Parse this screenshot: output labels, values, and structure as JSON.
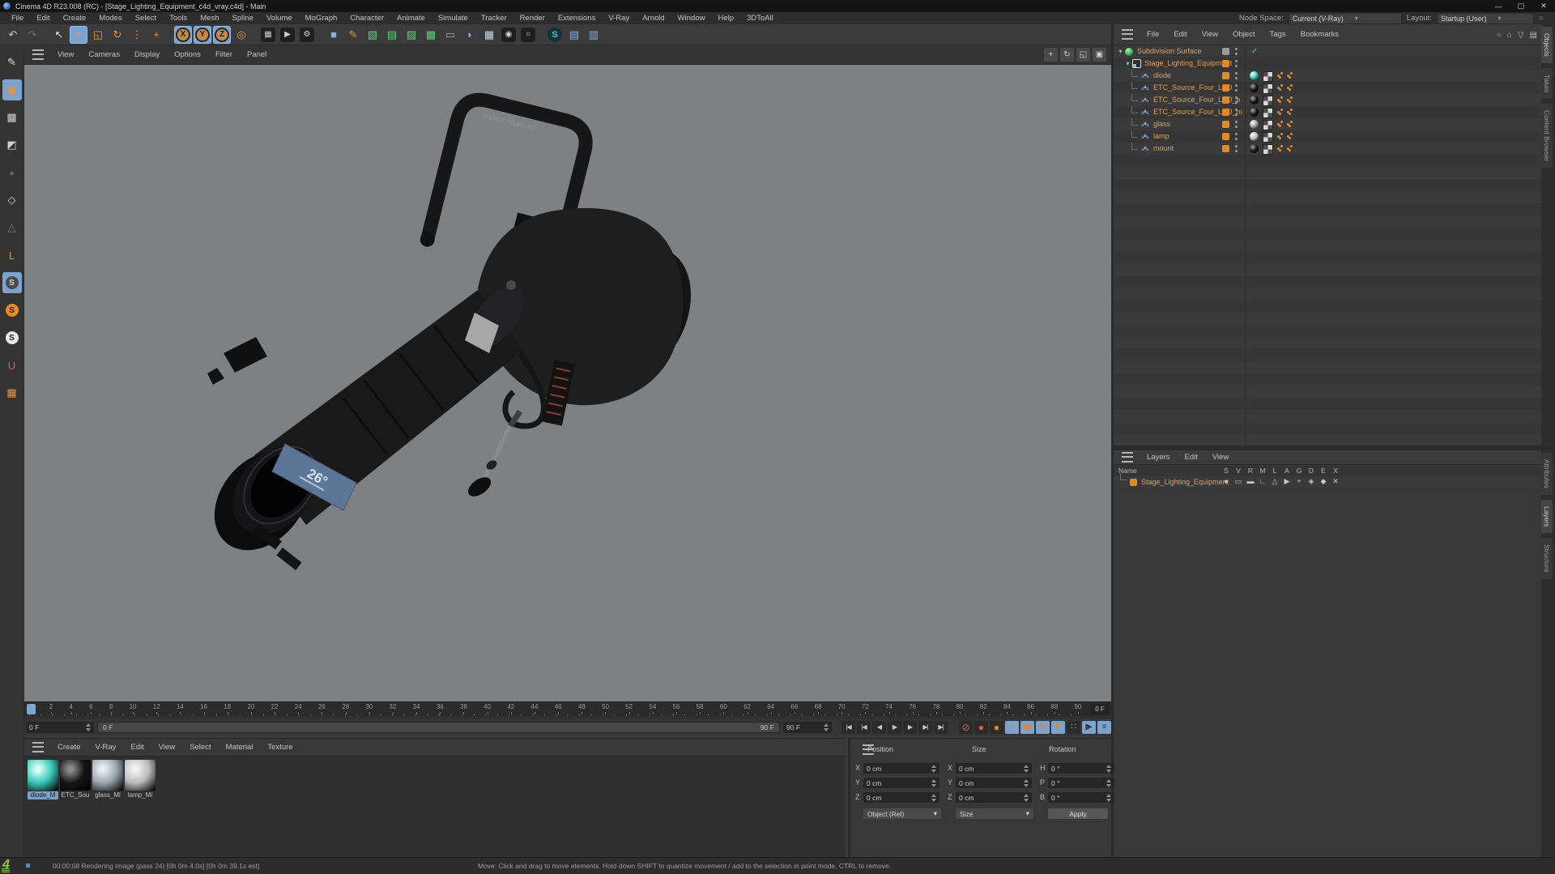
{
  "window": {
    "title": "Cinema 4D R23.008 (RC) - [Stage_Lighting_Equipment_c4d_vray.c4d] - Main",
    "minimize": "—",
    "maximize": "▢",
    "close": "✕"
  },
  "menubar": {
    "items": [
      "File",
      "Edit",
      "Create",
      "Modes",
      "Select",
      "Tools",
      "Mesh",
      "Spline",
      "Volume",
      "MoGraph",
      "Character",
      "Animate",
      "Simulate",
      "Tracker",
      "Render",
      "Extensions",
      "V-Ray",
      "Arnold",
      "Window",
      "Help",
      "3DToAll"
    ],
    "node_space_label": "Node Space:",
    "node_space_value": "Current (V-Ray)",
    "layout_label": "Layout:",
    "layout_value": "Startup (User)",
    "dropdown_caret": "▾"
  },
  "toolbar": {
    "items": [
      {
        "n": "undo-button",
        "g": "↶",
        "c": "#c8c8c8"
      },
      {
        "n": "redo-button",
        "g": "↷",
        "c": "#6a6a6a"
      },
      {
        "n": "sep"
      },
      {
        "n": "live-selection-tool",
        "g": "↖",
        "c": "#e6e6e6"
      },
      {
        "n": "move-tool",
        "g": "+",
        "c": "#e8953c",
        "active": 1
      },
      {
        "n": "scale-tool",
        "g": "◱",
        "c": "#e8953c"
      },
      {
        "n": "rotate-tool",
        "g": "↻",
        "c": "#e8953c"
      },
      {
        "n": "last-used-tool",
        "g": "⋮",
        "c": "#e8953c"
      },
      {
        "n": "tweak-mode-tool",
        "g": "+",
        "c": "#e8953c"
      },
      {
        "n": "sep"
      },
      {
        "n": "x-axis-lock",
        "g": "X",
        "active": 1,
        "rd": 1
      },
      {
        "n": "y-axis-lock",
        "g": "Y",
        "active": 1,
        "rd": 1
      },
      {
        "n": "z-axis-lock",
        "g": "Z",
        "active": 1,
        "rd": 1
      },
      {
        "n": "coordinate-system-toggle",
        "g": "◎",
        "c": "#e8953c"
      },
      {
        "n": "sep"
      },
      {
        "n": "render-view-button",
        "g": "▦",
        "c": "#d0d0d0",
        "dk": 1
      },
      {
        "n": "render-picture-viewer-button",
        "g": "▶",
        "c": "#d0d0d0",
        "dk": 1
      },
      {
        "n": "render-settings-button",
        "g": "⚙",
        "c": "#d0d0d0",
        "dk": 1
      },
      {
        "n": "sep"
      },
      {
        "n": "add-primitive-cube",
        "g": "■",
        "c": "#7fb2e5"
      },
      {
        "n": "add-spline-pen",
        "g": "✎",
        "c": "#e8953c"
      },
      {
        "n": "add-subdivision-surface",
        "g": "▧",
        "c": "#62cf7d"
      },
      {
        "n": "add-array-generator",
        "g": "▤",
        "c": "#62cf7d"
      },
      {
        "n": "add-symmetry-generator",
        "g": "▨",
        "c": "#62cf7d"
      },
      {
        "n": "add-volume-builder",
        "g": "▩",
        "c": "#62cf7d"
      },
      {
        "n": "add-deformer",
        "g": "▭",
        "c": "#b89ae0"
      },
      {
        "n": "add-field",
        "g": "◗",
        "c": "#8fa8e8"
      },
      {
        "n": "add-floor",
        "g": "▦",
        "c": "#c5d8ec"
      },
      {
        "n": "add-camera",
        "g": "◉",
        "c": "#d8d8d8",
        "dk": 1
      },
      {
        "n": "add-light",
        "g": "○",
        "c": "#e8e3c8",
        "dk": 1
      },
      {
        "n": "sep"
      },
      {
        "n": "vray-menu-button",
        "g": "S",
        "c": "#49c3c9",
        "vr": 1
      },
      {
        "n": "vray-scene-button",
        "g": "▤",
        "c": "#8fb0dd"
      },
      {
        "n": "vray-proxy-button",
        "g": "▥",
        "c": "#8fb0dd"
      }
    ]
  },
  "left_toolbar": {
    "items": [
      {
        "n": "tweak-tool-mode",
        "g": "✎",
        "c": "#d6d6d6"
      },
      {
        "n": "model-mode",
        "g": "▣",
        "c": "#e8953c",
        "active": 1
      },
      {
        "n": "texture-mode",
        "g": "▩",
        "c": "#cfcfcf"
      },
      {
        "n": "workplane-mode",
        "g": "◩",
        "c": "#cfcfcf"
      },
      {
        "n": "points-mode",
        "g": "▫",
        "c": "#cfcfcf"
      },
      {
        "n": "edges-mode",
        "g": "◇",
        "c": "#cfcfcf"
      },
      {
        "n": "polygons-mode",
        "g": "△",
        "c": "#7a7a7a"
      },
      {
        "n": "axis-mode",
        "g": "L",
        "c": "#e8953c"
      },
      {
        "n": "snap-toggle",
        "g": "S",
        "circ": "#4a4a4a",
        "c": "#d8d8d8",
        "active": 1
      },
      {
        "n": "snap-modes",
        "g": "S",
        "circ": "#e8891c",
        "c": "#2b1a05"
      },
      {
        "n": "snap-settings",
        "g": "S",
        "circ": "#e8e8e8",
        "c": "#222222"
      },
      {
        "n": "magnet-snap",
        "g": "U",
        "c": "#e85c2a"
      },
      {
        "n": "workplane-grid",
        "g": "▦",
        "c": "#e8953c"
      }
    ]
  },
  "viewport": {
    "menu": [
      "View",
      "Cameras",
      "Display",
      "Options",
      "Filter",
      "Panel"
    ],
    "nav": [
      {
        "n": "viewport-pan-icon",
        "g": "+"
      },
      {
        "n": "viewport-orbit-icon",
        "g": "↻"
      },
      {
        "n": "viewport-zoom-icon",
        "g": "◱"
      },
      {
        "n": "viewport-maximize-icon",
        "g": "▣"
      }
    ],
    "lens_label": "26°",
    "yoke_text": "SOURCE FOUR LED"
  },
  "object_manager": {
    "menu": [
      "File",
      "Edit",
      "View",
      "Object",
      "Tags",
      "Bookmarks"
    ],
    "icons": [
      {
        "n": "om-search-icon",
        "g": "○"
      },
      {
        "n": "om-home-icon",
        "g": "⌂"
      },
      {
        "n": "om-filter-icon",
        "g": "▽"
      },
      {
        "n": "om-browser-icon",
        "g": "▤"
      }
    ],
    "check_glyph": "✓",
    "caret_glyph": "▾",
    "tree": [
      {
        "name": "Subdivision Surface",
        "level": 0,
        "icon": "sds",
        "toggle": "gr",
        "check": 1
      },
      {
        "name": "Stage_Lighting_Equipment",
        "level": 1,
        "icon": "null",
        "toggle": "or"
      },
      {
        "name": "diode",
        "level": 2,
        "icon": "mesh",
        "toggle": "or",
        "mat": "#35c4b4",
        "hl": "#d8fff8"
      },
      {
        "name": "ETC_Source_Four_LED",
        "level": 2,
        "icon": "mesh",
        "toggle": "or",
        "mat": "#151515",
        "hl": "#909090"
      },
      {
        "name": "ETC_Source_Four_LED_e",
        "level": 2,
        "icon": "mesh",
        "toggle": "or",
        "mat": "#151515",
        "hl": "#909090"
      },
      {
        "name": "ETC_Source_Four_LED_m",
        "level": 2,
        "icon": "mesh",
        "toggle": "or",
        "mat": "#151515",
        "hl": "#909090"
      },
      {
        "name": "glass",
        "level": 2,
        "icon": "mesh",
        "toggle": "or",
        "mat": "#97a4ab",
        "hl": "#e8eef2"
      },
      {
        "name": "lamp",
        "level": 2,
        "icon": "mesh",
        "toggle": "or",
        "mat": "#b9b9b9",
        "hl": "#f4f4f4"
      },
      {
        "name": "mount",
        "level": 2,
        "icon": "mesh",
        "toggle": "or",
        "mat": "#151515",
        "hl": "#909090"
      }
    ]
  },
  "layers_panel": {
    "menu": [
      "Layers",
      "Edit",
      "View"
    ],
    "name_header": "Name",
    "columns": [
      "S",
      "V",
      "R",
      "M",
      "L",
      "A",
      "G",
      "D",
      "E",
      "X"
    ],
    "row": {
      "name": "Stage_Lighting_Equipment",
      "color": "#e8891c",
      "icons": [
        "●",
        "▭",
        "▬",
        "∟",
        "△",
        "▶",
        "+",
        "◈",
        "◆",
        "✕"
      ]
    }
  },
  "side_tabs": {
    "top": [
      "Objects",
      "Takes",
      "Content Browser"
    ],
    "bottom": [
      "Attributes",
      "Layers",
      "Structure"
    ]
  },
  "timeline": {
    "ticks": [
      0,
      2,
      4,
      6,
      8,
      10,
      12,
      14,
      16,
      18,
      20,
      22,
      24,
      26,
      28,
      30,
      32,
      34,
      36,
      38,
      40,
      42,
      44,
      46,
      48,
      50,
      52,
      54,
      56,
      58,
      60,
      62,
      64,
      66,
      68,
      70,
      72,
      74,
      76,
      78,
      80,
      82,
      84,
      86,
      88,
      90
    ],
    "current": "0 F",
    "range_start": "0 F",
    "range_end": "90 F",
    "end_value": "90 F",
    "transport": [
      {
        "n": "goto-start-button",
        "g": "|◀"
      },
      {
        "n": "prev-key-button",
        "g": "|◀"
      },
      {
        "n": "prev-frame-button",
        "g": "◀"
      },
      {
        "n": "play-button",
        "g": "▶"
      },
      {
        "n": "next-frame-button",
        "g": "▶"
      },
      {
        "n": "next-key-button",
        "g": "▶|"
      },
      {
        "n": "goto-end-button",
        "g": "▶|"
      }
    ],
    "record": [
      {
        "n": "autokey-toggle",
        "g": "⊘",
        "cls": "red"
      },
      {
        "n": "record-objects-toggle",
        "g": "●",
        "cls": "red"
      },
      {
        "n": "record-keyframe-button",
        "g": "●",
        "cls": "okey"
      },
      {
        "n": "key-position-toggle",
        "g": "+",
        "cls": "bkey"
      },
      {
        "n": "key-scale-toggle",
        "g": "▣",
        "cls": "bkey"
      },
      {
        "n": "key-rotation-toggle",
        "g": "↻",
        "cls": "bkey"
      },
      {
        "n": "key-parameter-toggle",
        "g": "P",
        "cls": "bkey"
      },
      {
        "n": "key-pla-toggle",
        "g": "∷",
        "cls": "dark"
      },
      {
        "n": "solo-toggle",
        "g": "▶",
        "cls": "bkey2"
      },
      {
        "n": "solo-mode-button",
        "g": "≡",
        "cls": "bkey2"
      }
    ]
  },
  "materials": {
    "menu": [
      "Create",
      "V-Ray",
      "Edit",
      "View",
      "Select",
      "Material",
      "Texture"
    ],
    "items": [
      {
        "name": "diode_M",
        "color": "#35c4b4",
        "hl": "#d8fff8",
        "selected": true
      },
      {
        "name": "ETC_Sou",
        "color": "#141414",
        "hl": "#8a8a8a"
      },
      {
        "name": "glass_Mi",
        "color": "#97a4ab",
        "hl": "#e8eef2"
      },
      {
        "name": "lamp_Mi",
        "color": "#b9b9b9",
        "hl": "#f2f2f2"
      }
    ]
  },
  "coordinates": {
    "headers": [
      "Position",
      "Size",
      "Rotation"
    ],
    "rows": [
      {
        "l1": "X",
        "v1": "0 cm",
        "l2": "X",
        "v2": "0 cm",
        "l3": "H",
        "v3": "0 °"
      },
      {
        "l1": "Y",
        "v1": "0 cm",
        "l2": "Y",
        "v2": "0 cm",
        "l3": "P",
        "v3": "0 °"
      },
      {
        "l1": "Z",
        "v1": "0 cm",
        "l2": "Z",
        "v2": "0 cm",
        "l3": "B",
        "v3": "0 °"
      }
    ],
    "mode": "Object (Rel)",
    "size_mode": "Size",
    "apply": "Apply",
    "dropdown_caret": "▾"
  },
  "statusbar": {
    "logo": "4",
    "render_status": "00:00:08 Rendering Image (pass 24) [0h  0m  4.0s] [0h  0m 39.1s est]",
    "hint": "Move: Click and drag to move elements. Hold down SHIFT to quantize movement / add to the selection in point mode, CTRL to remove."
  }
}
